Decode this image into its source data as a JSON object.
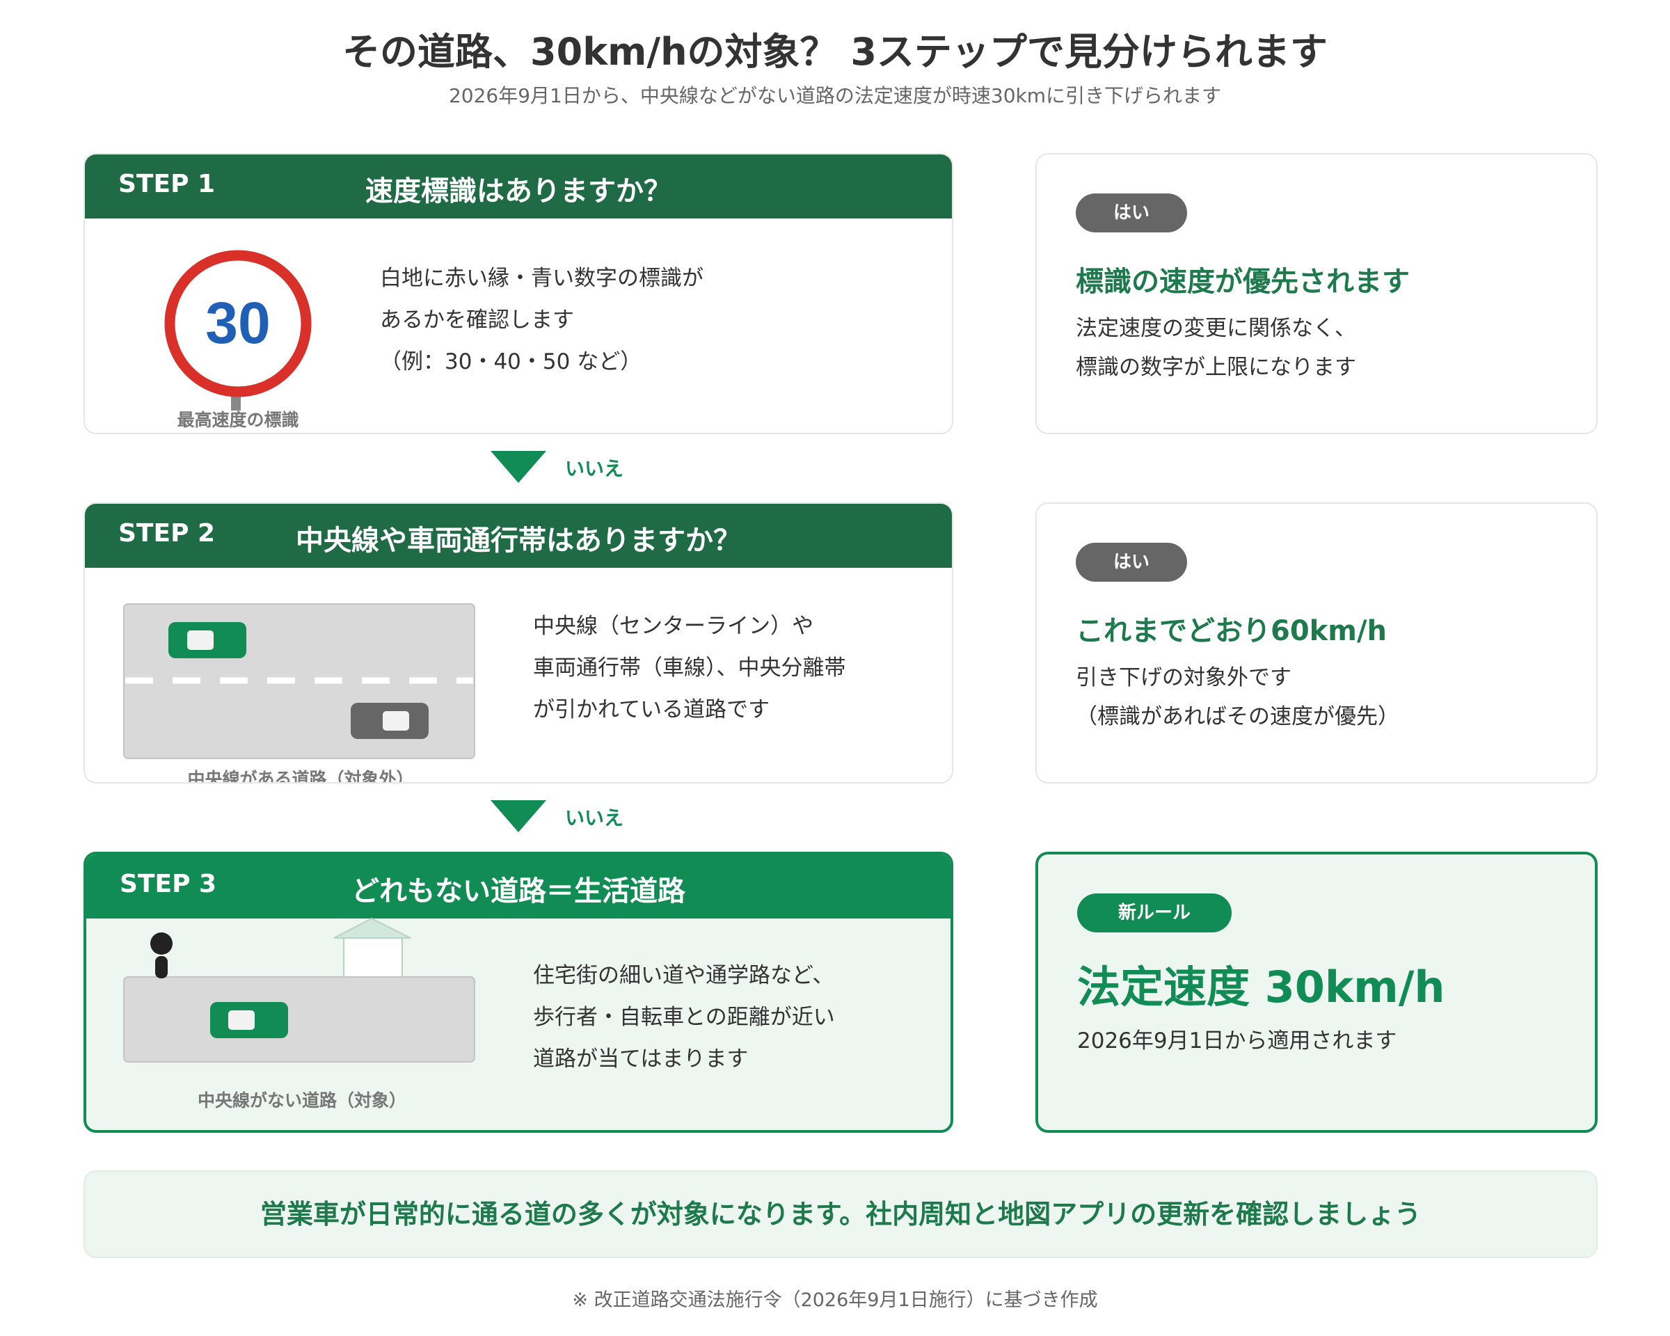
{
  "header": {
    "title": "その道路、30km/hの対象？ 3ステップで見分けられます",
    "subtitle": "2026年9月1日から、中央線などがない道路の法定速度が時速30kmに引き下げられます"
  },
  "steps": [
    {
      "label": "STEP 1",
      "question": "速度標識はありますか？",
      "sign_number": "30",
      "caption": "最高速度の標識",
      "desc": [
        "白地に赤い縁・青い数字の標識が",
        "あるかを確認します",
        "（例：30・40・50 など）"
      ]
    },
    {
      "label": "STEP 2",
      "question": "中央線や車両通行帯はありますか？",
      "caption": "中央線がある道路（対象外）",
      "desc": [
        "中央線（センターライン）や",
        "車両通行帯（車線）、中央分離帯",
        "が引かれている道路です"
      ]
    },
    {
      "label": "STEP 3",
      "question": "どれもない道路＝生活道路",
      "caption": "中央線がない道路（対象）",
      "desc": [
        "住宅街の細い道や通学路など、",
        "歩行者・自転車との距離が近い",
        "道路が当てはまります"
      ]
    }
  ],
  "arrows": [
    "いいえ",
    "いいえ"
  ],
  "answers": [
    {
      "pill": "はい",
      "title": "標識の速度が優先されます",
      "text": [
        "法定速度の変更に関係なく、",
        "標識の数字が上限になります"
      ]
    },
    {
      "pill": "はい",
      "title": "これまでどおり60km/h",
      "text": [
        "引き下げの対象外です",
        "（標識があればその速度が優先）"
      ]
    },
    {
      "pill": "新ルール",
      "title": "法定速度 30km/h",
      "text": [
        "2026年9月1日から適用されます"
      ]
    }
  ],
  "banner": "営業車が日常的に通る道の多くが対象になります。社内周知と地図アプリの更新を確認しましょう",
  "footnote": "※ 改正道路交通法施行令（2026年9月1日施行）に基づき作成",
  "colors": {
    "dark_green": "#1e6b46",
    "green": "#128c55",
    "light_green_bg": "#eef6f1",
    "sign_red": "#d9302a",
    "sign_blue": "#1f5fb5",
    "gray_pill": "#666666",
    "road": "#d9d9d9"
  }
}
